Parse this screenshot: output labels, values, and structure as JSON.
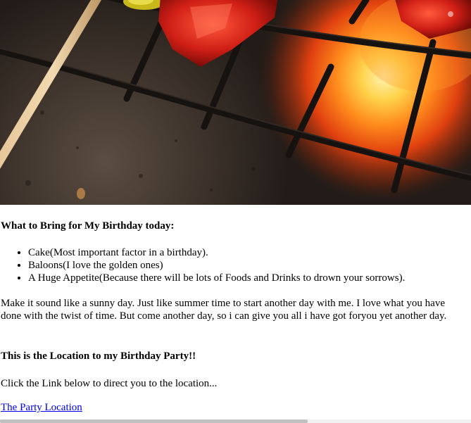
{
  "hero": {
    "image_subject": "kebab skewers grilling over hot coals"
  },
  "section_bring": {
    "heading": "What to Bring for My Birthday today:",
    "items": [
      "Cake(Most important factor in a birthday).",
      "Baloons(I love the golden ones)",
      "A Huge Appetite(Because there will be lots of Foods and Drinks to drown your sorrows)."
    ]
  },
  "paragraph": "Make it sound like a sunny day. Just like summer time to start another day with me. I love what you have done with the twist of time. But come another day, so i can give you all i have got foryou yet another day.",
  "section_location": {
    "heading": "This is the Location to my Birthday Party!!",
    "intro": "Click the Link below to direct you to the location...",
    "link_text": "The Party Location"
  },
  "colors": {
    "link": "#0000ee",
    "text": "#000000",
    "background": "#ffffff"
  }
}
